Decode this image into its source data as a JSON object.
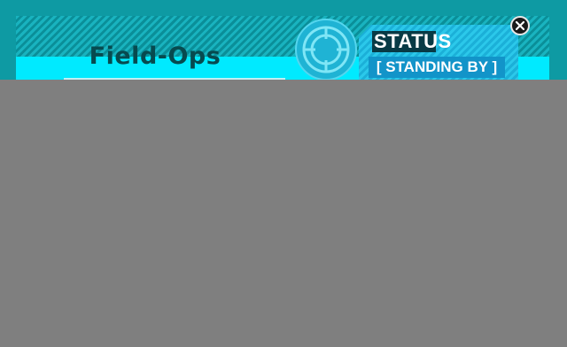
{
  "window": {
    "title": "Field-Ops"
  },
  "status": {
    "label": "STATUS",
    "value": "[ STANDING BY ]"
  },
  "icons": {
    "close": "close-icon",
    "reticle": "crosshair-icon"
  },
  "colors": {
    "frame": "#0e9aa3",
    "accent_cyan": "#00eaff",
    "title_text": "#074a4f",
    "status_panel": "#2bc8ea",
    "status_value_bg": "#1294c9",
    "overlay": "#7f7f7f"
  }
}
